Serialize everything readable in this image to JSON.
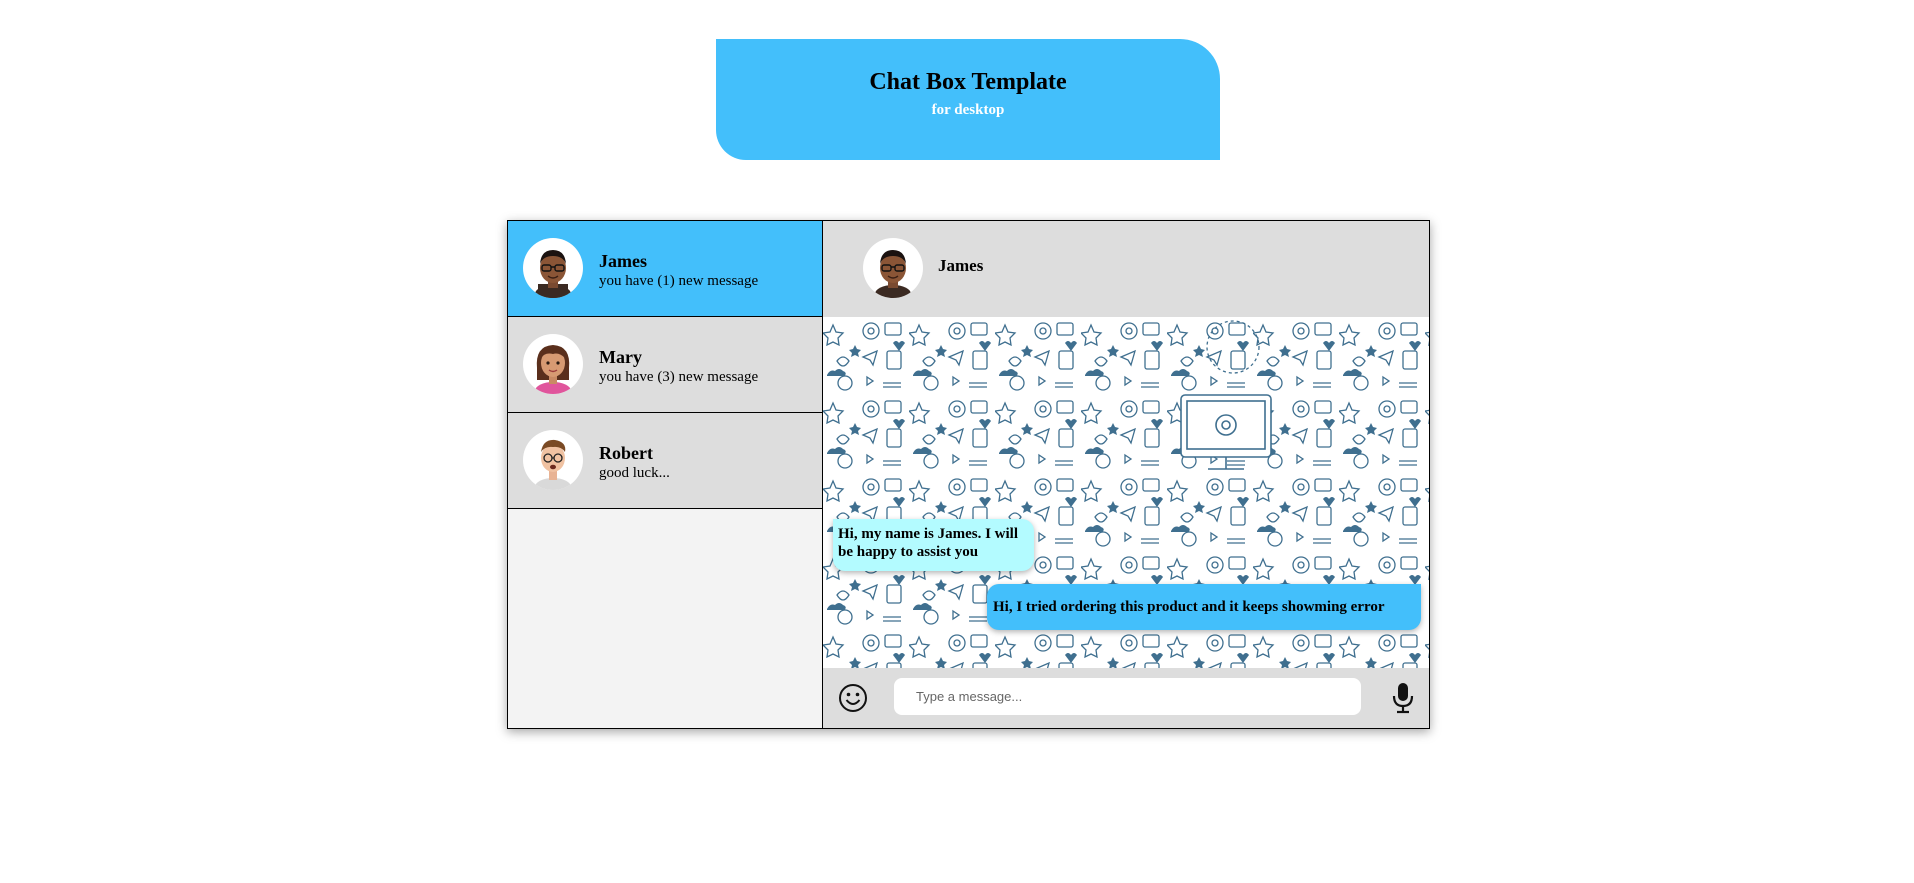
{
  "header": {
    "title": "Chat Box Template",
    "subtitle": "for desktop"
  },
  "colors": {
    "accent": "#43bffb",
    "incoming_bubble": "#b3fbff",
    "panel_gray": "#dddddd",
    "sidebar_bg": "#f3f3f3",
    "pattern_stroke": "#3f6f8f"
  },
  "contacts": [
    {
      "name": "James",
      "preview": "you have (1) new message",
      "active": true,
      "avatar": "man-glasses-avatar"
    },
    {
      "name": "Mary",
      "preview": "you have (3) new message",
      "active": false,
      "avatar": "woman-avatar"
    },
    {
      "name": "Robert",
      "preview": "good luck...",
      "active": false,
      "avatar": "man-glasses-beard-avatar"
    }
  ],
  "chat": {
    "contact_name": "James",
    "messages": [
      {
        "direction": "incoming",
        "text": "Hi, my name is James. I will be happy to assist you"
      },
      {
        "direction": "outgoing",
        "text": "Hi, I tried ordering this product and it keeps showming error"
      }
    ],
    "input_placeholder": "Type a message...",
    "input_value": "",
    "icons": {
      "emoji": "smiley-icon",
      "mic": "microphone-icon"
    }
  }
}
